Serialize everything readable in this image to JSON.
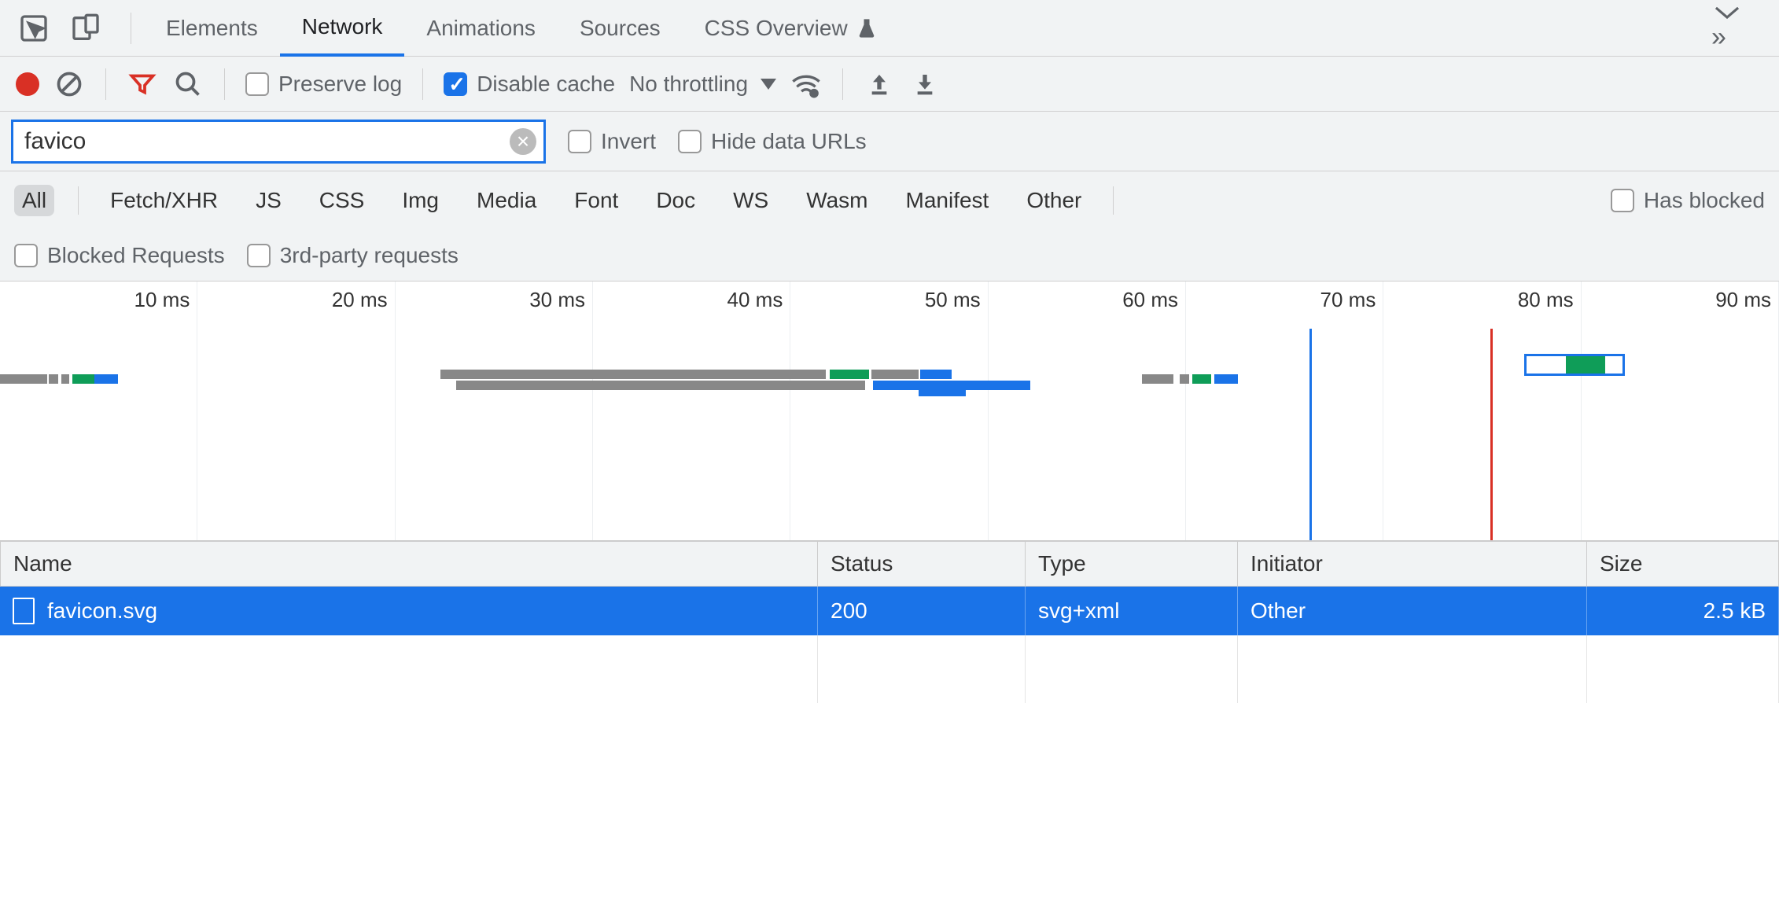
{
  "tabs": {
    "items": [
      "Elements",
      "Network",
      "Animations",
      "Sources",
      "CSS Overview"
    ],
    "active_index": 1
  },
  "toolbar": {
    "preserve_log_label": "Preserve log",
    "preserve_log_checked": false,
    "disable_cache_label": "Disable cache",
    "disable_cache_checked": true,
    "throttling_label": "No throttling"
  },
  "filter": {
    "value": "favico",
    "invert_label": "Invert",
    "invert_checked": false,
    "hide_data_urls_label": "Hide data URLs",
    "hide_data_urls_checked": false
  },
  "type_filters": {
    "items": [
      "All",
      "Fetch/XHR",
      "JS",
      "CSS",
      "Img",
      "Media",
      "Font",
      "Doc",
      "WS",
      "Wasm",
      "Manifest",
      "Other"
    ],
    "selected_index": 0,
    "has_blocked_label": "Has blocked",
    "has_blocked_checked": false,
    "blocked_requests_label": "Blocked Requests",
    "blocked_requests_checked": false,
    "third_party_label": "3rd-party requests",
    "third_party_checked": false
  },
  "timeline": {
    "ticks_ms": [
      10,
      20,
      30,
      40,
      50,
      60,
      70,
      80,
      90
    ],
    "unit": "ms",
    "marker_blue_ms": 65,
    "marker_red_ms": 74,
    "selection_ms": [
      76,
      81
    ]
  },
  "table": {
    "headers": [
      "Name",
      "Status",
      "Type",
      "Initiator",
      "Size"
    ],
    "rows": [
      {
        "name": "favicon.svg",
        "status": "200",
        "type": "svg+xml",
        "initiator": "Other",
        "size": "2.5 kB"
      }
    ]
  }
}
